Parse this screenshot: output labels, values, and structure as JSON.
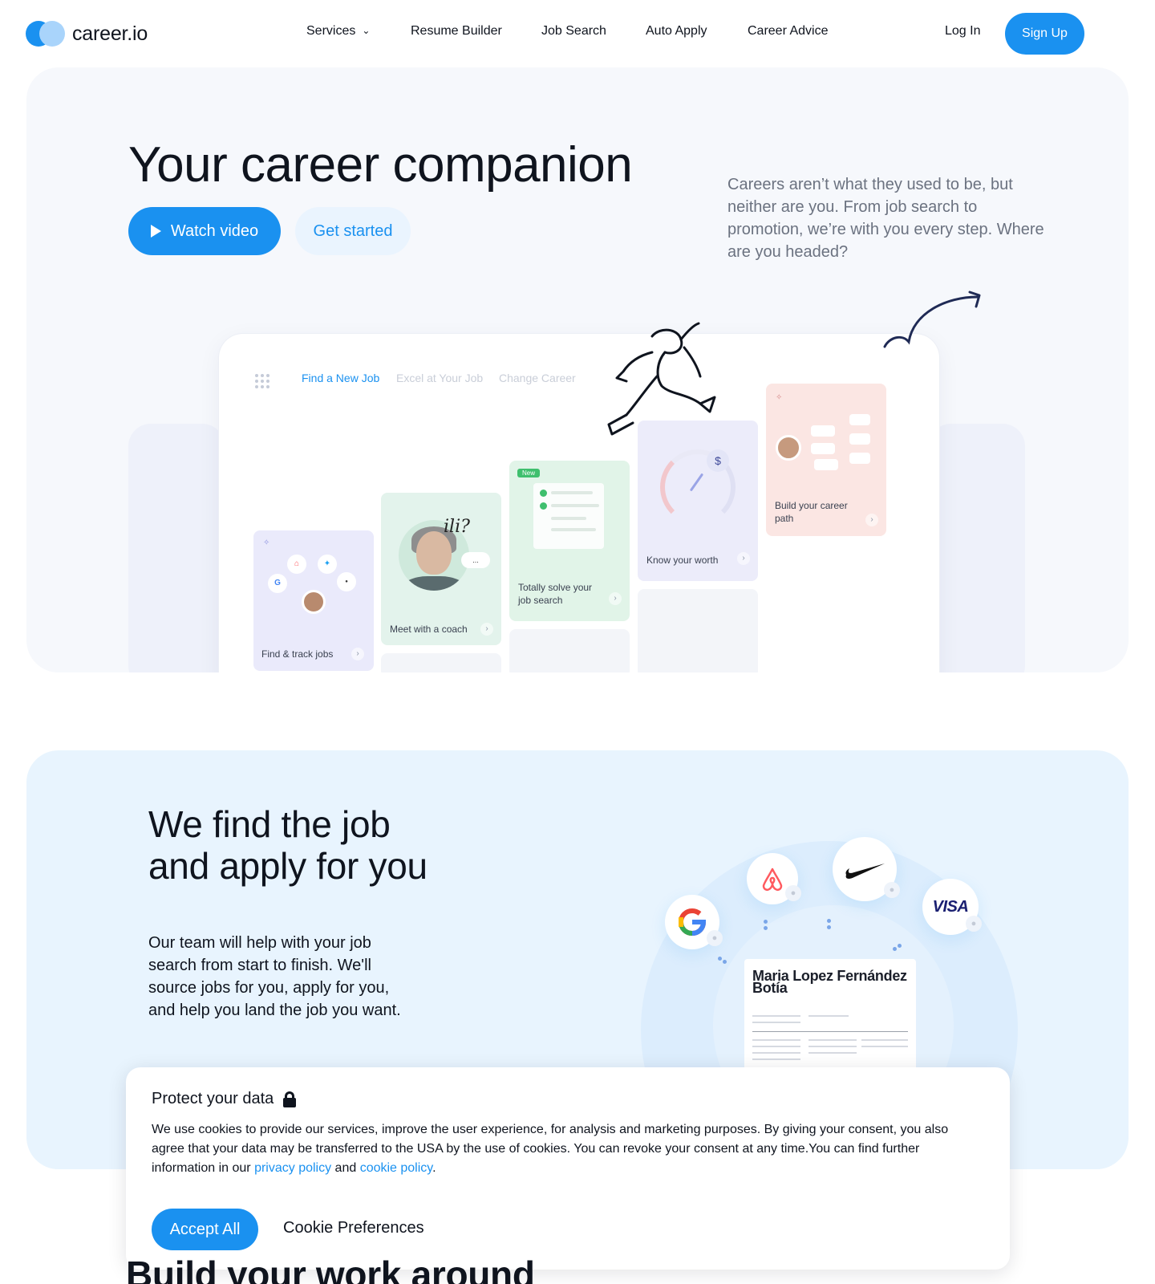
{
  "brand": {
    "name": "career.io",
    "colors": {
      "primary": "#1a91f0",
      "primary_light": "#a9d4fb",
      "text": "#0f141e",
      "muted": "#6b7280"
    }
  },
  "nav": {
    "links": [
      {
        "label": "Services",
        "has_dropdown": true,
        "icon": "chevron-down-icon"
      },
      {
        "label": "Resume Builder"
      },
      {
        "label": "Job Search"
      },
      {
        "label": "Auto Apply"
      },
      {
        "label": "Career Advice"
      }
    ],
    "login": "Log In",
    "signup": "Sign Up"
  },
  "hero": {
    "title": "Your career companion",
    "watch_video": "Watch video",
    "get_started": "Get started",
    "description": "Careers aren’t what they used to be, but neither are you. From job search to promotion, we’re with you every step. Where are you headed?",
    "device": {
      "tabs": [
        {
          "label": "Find a New Job",
          "active": true
        },
        {
          "label": "Excel at Your Job",
          "active": false
        },
        {
          "label": "Change Career",
          "active": false
        }
      ],
      "cards": {
        "find": "Find & track jobs",
        "coach": "Meet with a coach",
        "solve_badge": "New",
        "solve": "Totally solve your job search",
        "worth": "Know your worth",
        "path": "Build your career path"
      },
      "coach_bubble": "...",
      "dollar": "$"
    }
  },
  "apply": {
    "title": "We find the job and apply for you",
    "description": "Our team will help with your job search from start to finish. We'll source jobs for you, apply for you, and help you land the job you want.",
    "logos": [
      "google-logo",
      "airbnb-logo",
      "nike-logo",
      "visa-logo"
    ],
    "visa_text": "VISA",
    "resume_name": "Maria Lopez Fernández Botía"
  },
  "cookie": {
    "title": "Protect your data",
    "text_before": "We use cookies to provide our services, improve the user experience, for analysis and marketing purposes. By giving your consent, you also agree that your data may be transferred to the USA by the use of cookies. You can revoke your consent at any time.You can find further information in our ",
    "privacy_link": "privacy policy",
    "and": " and ",
    "cookie_link": "cookie policy",
    "period": ".",
    "accept": "Accept All",
    "preferences": "Cookie Preferences"
  },
  "next_section": {
    "title": "Build your work around"
  }
}
